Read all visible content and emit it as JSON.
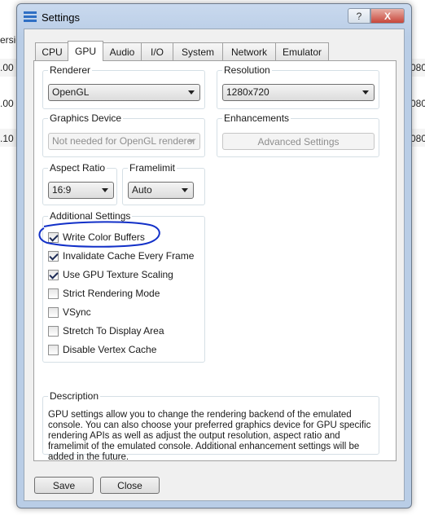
{
  "background": {
    "column_header": "ersio",
    "rows": [
      {
        "left": ".00",
        "right": "080"
      },
      {
        "left": ".00",
        "right": "080"
      },
      {
        "left": ".10",
        "right": "080"
      }
    ]
  },
  "window": {
    "title": "Settings",
    "help_symbol": "?",
    "close_symbol": "X"
  },
  "tabs": [
    {
      "label": "CPU",
      "active": false
    },
    {
      "label": "GPU",
      "active": true
    },
    {
      "label": "Audio",
      "active": false
    },
    {
      "label": "I/O",
      "active": false
    },
    {
      "label": "System",
      "active": false
    },
    {
      "label": "Network",
      "active": false
    },
    {
      "label": "Emulator",
      "active": false
    }
  ],
  "renderer": {
    "title": "Renderer",
    "value": "OpenGL"
  },
  "resolution": {
    "title": "Resolution",
    "value": "1280x720"
  },
  "graphics_device": {
    "title": "Graphics Device",
    "value": "Not needed for OpenGL renderer"
  },
  "enhancements": {
    "title": "Enhancements",
    "button": "Advanced Settings"
  },
  "aspect_ratio": {
    "title": "Aspect Ratio",
    "value": "16:9"
  },
  "framelimit": {
    "title": "Framelimit",
    "value": "Auto"
  },
  "additional": {
    "title": "Additional Settings",
    "options": [
      {
        "label": "Write Color Buffers",
        "checked": true
      },
      {
        "label": "Invalidate Cache Every Frame",
        "checked": true
      },
      {
        "label": "Use GPU Texture Scaling",
        "checked": true
      },
      {
        "label": "Strict Rendering Mode",
        "checked": false
      },
      {
        "label": "VSync",
        "checked": false
      },
      {
        "label": "Stretch To Display Area",
        "checked": false
      },
      {
        "label": "Disable Vertex Cache",
        "checked": false
      }
    ]
  },
  "description": {
    "title": "Description",
    "text": "GPU settings allow you to change the rendering backend of the emulated console. You can also choose your preferred graphics device for GPU specific rendering APIs as well as adjust the output resolution, aspect ratio and framelimit of the emulated console. Additional enhancement settings will be added in the future."
  },
  "footer": {
    "save": "Save",
    "close": "Close"
  },
  "colors": {
    "annotation": "#1230c8",
    "window_frame": "#b9cde6"
  }
}
